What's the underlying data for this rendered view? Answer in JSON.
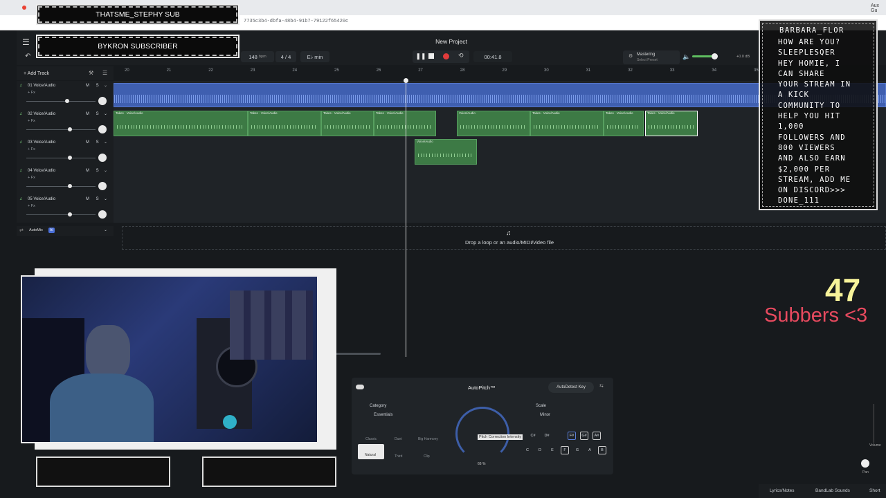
{
  "browser": {
    "url": "7735c3b4-dbfa-48b4-91b7-79122f65420c",
    "right_label": "Aux Gu"
  },
  "overlays": {
    "top_sub": "THATSME_STEPHY SUB",
    "second_sub": "BYKRON SUBSCRIBER",
    "chat_user": "BARBARA_FLOR",
    "chat_lines": [
      "HOW ARE YOU?",
      "SLEEPLESQER",
      "HEY HOMIE, I",
      "CAN SHARE",
      "YOUR STREAM IN",
      "A KICK",
      "COMMUNITY TO",
      "HELP YOU HIT",
      "1,000",
      "FOLLOWERS AND",
      "800 VIEWERS",
      "AND ALSO EARN",
      "$2,000 PER",
      "STREAM, ADD ME",
      "ON DISCORD>>>",
      "DONE_111"
    ],
    "sub_count": "47",
    "sub_label": "Subbers <3"
  },
  "header": {
    "project_title": "New Project",
    "bpm": "148",
    "bpm_unit": "bpm",
    "time_sig": "4 / 4",
    "key": "E♭ min",
    "time": "00:41.8",
    "mastering": "Mastering",
    "mastering_sub": "Select Preset",
    "db": "+0.0 dB",
    "add_track": "+ Add Track"
  },
  "ruler": [
    "20",
    "21",
    "22",
    "23",
    "24",
    "25",
    "26",
    "27",
    "28",
    "29",
    "30",
    "31",
    "32",
    "33",
    "34",
    "35"
  ],
  "tracks": [
    {
      "name": "01 Voice/Audio",
      "fx": "+ Fx",
      "ms": "M S"
    },
    {
      "name": "02 Voice/Audio",
      "fx": "+ Fx",
      "ms": "M S"
    },
    {
      "name": "03 Voice/Audio",
      "fx": "+ Fx",
      "ms": "M S"
    },
    {
      "name": "04 Voice/Audio",
      "fx": "+ Fx",
      "ms": "M S"
    },
    {
      "name": "05 Voice/Audio",
      "fx": "+ Fx",
      "ms": "M S"
    }
  ],
  "clips": {
    "takes": "Takes · Voice/Audio",
    "voice": "Voice/Audio"
  },
  "automix": "AutoMix",
  "automix_badge": "AI",
  "drop_text": "Drop a loop or an audio/MIDI/video file",
  "autopitch": {
    "title": "AutoPitch™",
    "detect": "AutoDetect Key",
    "category_label": "Category",
    "category_value": "Essentials",
    "scale_label": "Scale",
    "scale_value": "Minor",
    "modes": [
      "Classic",
      "Duet",
      "Big Harmony",
      "Natural",
      "Third",
      "Clip"
    ],
    "tooltip": "Pitch Correction Intensity",
    "percent": "66 %",
    "keys": [
      "C",
      "D",
      "E",
      "F",
      "G",
      "A",
      "B"
    ],
    "sharps": [
      "C#",
      "D#",
      "F#",
      "G#",
      "A#"
    ]
  },
  "footer": {
    "lyrics": "Lyrics/Notes",
    "sounds": "BandLab Sounds",
    "shortcuts": "Short",
    "volume": "Volume",
    "pan": "Pan"
  }
}
